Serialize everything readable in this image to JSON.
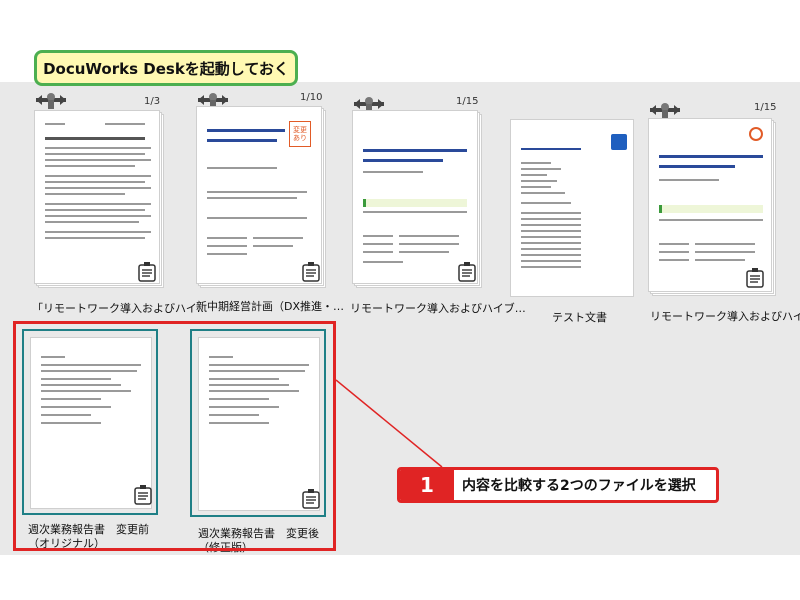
{
  "title_banner": "DocuWorks Deskを起動しておく",
  "documents": [
    {
      "caption": "「リモートワーク導入およびハイ…",
      "page_count": "1/3"
    },
    {
      "caption": "新中期経営計画（DX推進・…",
      "page_count": "1/10",
      "stamp_text": "変更あり"
    },
    {
      "caption": "リモートワーク導入およびハイブ…",
      "page_count": "1/15"
    },
    {
      "caption": "テスト文書",
      "page_count": ""
    },
    {
      "caption": "リモートワーク導入およびハイブ…",
      "page_count": "1/15"
    },
    {
      "caption": "週次業務報告書　変更前（オリジナル）",
      "page_count": ""
    },
    {
      "caption": "週次業務報告書　変更後（修正版）",
      "page_count": ""
    }
  ],
  "callout": {
    "number": "1",
    "text": "内容を比較する2つのファイルを選択"
  },
  "colors": {
    "accent_red": "#e02424",
    "selection_teal": "#1f7f86",
    "banner_fill": "#fff9b3",
    "banner_border": "#4caf50"
  }
}
